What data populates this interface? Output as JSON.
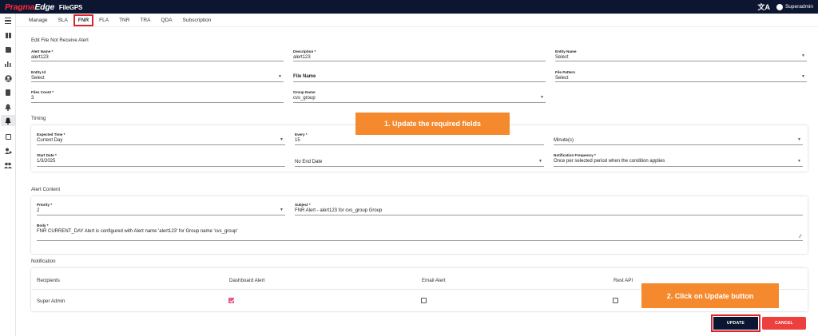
{
  "brand": {
    "name_part1": "Pragma",
    "name_part2": "Edge",
    "product": "FileGPS",
    "accent": "#ff2a3a",
    "bar_color": "#0d1630"
  },
  "header": {
    "translate_icon": "translate-icon",
    "user": "Superadmin"
  },
  "rail": {
    "icons": [
      "menu-icon",
      "dashboard-icon",
      "files-icon",
      "chart-icon",
      "user-icon",
      "document-icon",
      "bell-icon",
      "alert-bell-icon",
      "settings-icon",
      "user-settings-icon",
      "group-icon"
    ]
  },
  "tabs": [
    {
      "label": "Manage"
    },
    {
      "label": "SLA"
    },
    {
      "label": "FNR",
      "active": true
    },
    {
      "label": "FLA"
    },
    {
      "label": "TNR"
    },
    {
      "label": "TRA"
    },
    {
      "label": "QDA"
    },
    {
      "label": "Subscription"
    }
  ],
  "form": {
    "title": "Edit File Not Receive Alert",
    "alert_name": {
      "label": "Alert Name *",
      "value": "alert123"
    },
    "description": {
      "label": "Description *",
      "value": "alert123"
    },
    "entity_name": {
      "label": "Entity Name",
      "value": "Select"
    },
    "entity_id": {
      "label": "Entity Id",
      "value": "Select"
    },
    "file_name": {
      "label": "File Name"
    },
    "file_pattern": {
      "label": "File Pattern",
      "value": "Select"
    },
    "files_count": {
      "label": "Files Count *",
      "value": "3"
    },
    "group_name": {
      "label": "Group Name",
      "value": "cvs_group"
    }
  },
  "timing": {
    "title": "Timing",
    "expected_time": {
      "label": "Expected Time *",
      "value": "Current Day"
    },
    "every": {
      "label": "Every *",
      "value": "15"
    },
    "unit": {
      "value": "Minute(s)"
    },
    "start_date": {
      "label": "Start Date *",
      "value": "1/3/2025"
    },
    "end_date": {
      "value": "No End Date"
    },
    "frequency": {
      "label": "Notification Frequency *",
      "value": "Once per selected period when the condition applies"
    }
  },
  "content": {
    "title": "Alert Content",
    "priority": {
      "label": "Priority *",
      "value": "2"
    },
    "subject": {
      "label": "Subject *",
      "value": "FNR Alert - alert123 for cvs_group Group"
    },
    "body": {
      "label": "Body *",
      "value": "FNR CURRENT_DAY Alert is configured with Alert name 'alert123' for Group name 'cvs_group'"
    }
  },
  "notification": {
    "title": "Notification",
    "columns": [
      "Recipients",
      "Dashboard Alert",
      "Email Alert",
      "Rest API"
    ],
    "rows": [
      {
        "recipient": "Super Admin",
        "dashboard": true,
        "email": false,
        "rest": false
      }
    ]
  },
  "callouts": {
    "c1": "1. Update the required fields",
    "c2": "2. Click on Update button",
    "color": "#f5892e"
  },
  "buttons": {
    "update": "UPDATE",
    "cancel": "CANCEL"
  }
}
